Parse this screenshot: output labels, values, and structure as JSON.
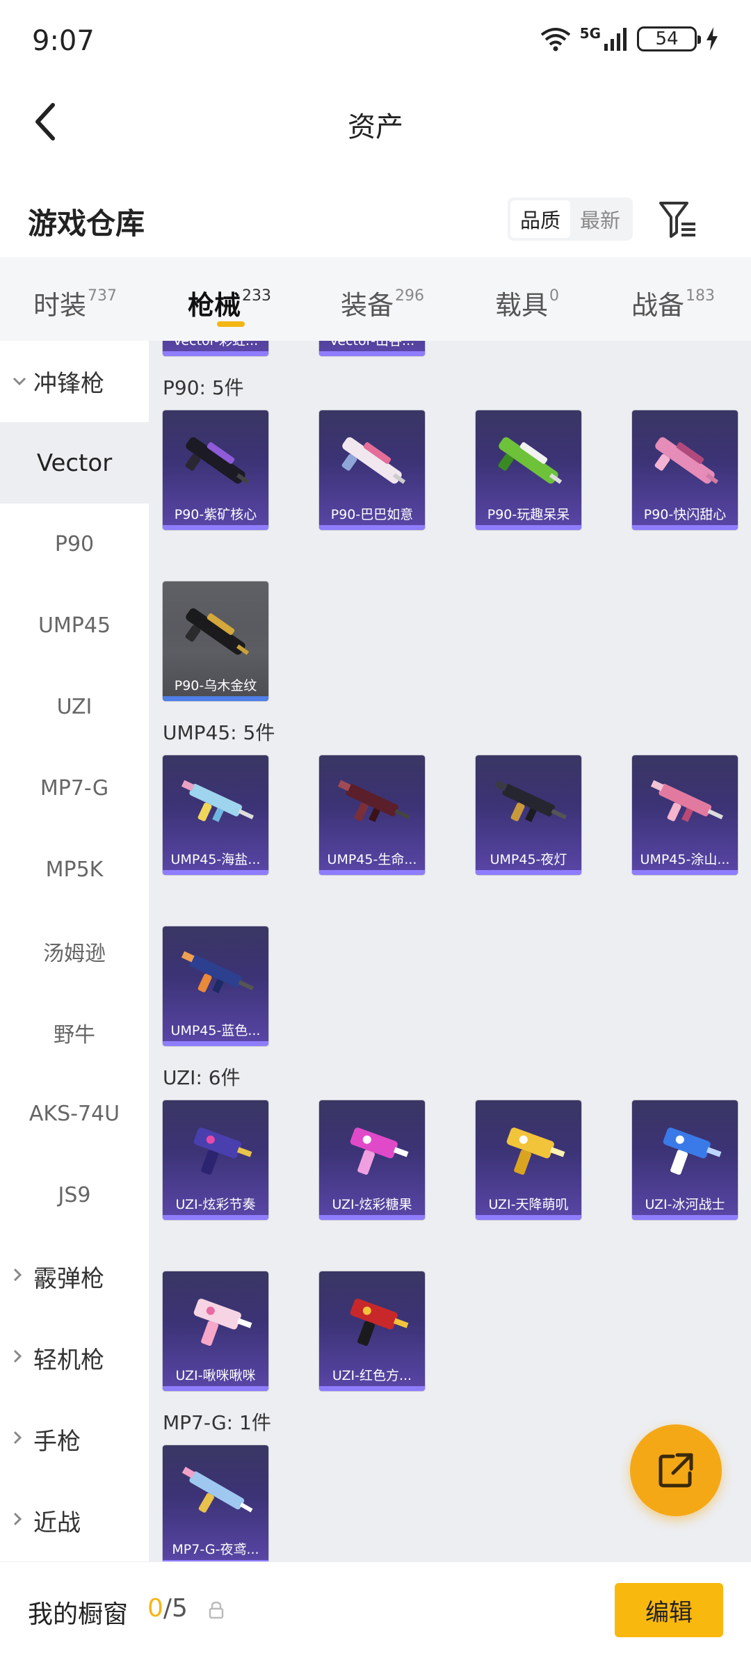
{
  "status_bar": {
    "time": "9:07",
    "network": "5G",
    "battery": "54"
  },
  "nav": {
    "title": "资产"
  },
  "warehouse": {
    "title": "游戏仓库",
    "sort": [
      "品质",
      "最新"
    ]
  },
  "tabs": [
    {
      "label": "时装",
      "count": "737"
    },
    {
      "label": "枪械",
      "count": "233"
    },
    {
      "label": "装备",
      "count": "296"
    },
    {
      "label": "载具",
      "count": "0"
    },
    {
      "label": "战备",
      "count": "183"
    }
  ],
  "sidebar": {
    "category_open": "冲锋枪",
    "items": [
      "Vector",
      "P90",
      "UMP45",
      "UZI",
      "MP7-G",
      "MP5K",
      "汤姆逊",
      "野牛",
      "AKS-74U",
      "JS9"
    ],
    "categories": [
      "霰弹枪",
      "轻机枪",
      "手枪",
      "近战"
    ]
  },
  "content": {
    "partial_top": [
      "Vector-彩虹...",
      "Vector-山谷..."
    ],
    "groups": [
      {
        "title": "P90: 5件",
        "items": [
          "P90-紫矿核心",
          "P90-巴巴如意",
          "P90-玩趣呆呆",
          "P90-快闪甜心",
          "P90-乌木金纹"
        ]
      },
      {
        "title": "UMP45: 5件",
        "items": [
          "UMP45-海盐...",
          "UMP45-生命...",
          "UMP45-夜灯",
          "UMP45-涂山...",
          "UMP45-蓝色..."
        ]
      },
      {
        "title": "UZI: 6件",
        "items": [
          "UZI-炫彩节奏",
          "UZI-炫彩糖果",
          "UZI-天降萌叽",
          "UZI-冰河战士",
          "UZI-啾咪啾咪",
          "UZI-红色方..."
        ]
      },
      {
        "title": "MP7-G: 1件",
        "items": [
          "MP7-G-夜鸢..."
        ]
      }
    ]
  },
  "bottom": {
    "label": "我的橱窗",
    "current": "0",
    "total": "/5",
    "edit": "编辑"
  },
  "colors": {
    "accent": "#f9b80e",
    "card_purple": "#3d3478",
    "card_gray": "#5c5d63"
  }
}
